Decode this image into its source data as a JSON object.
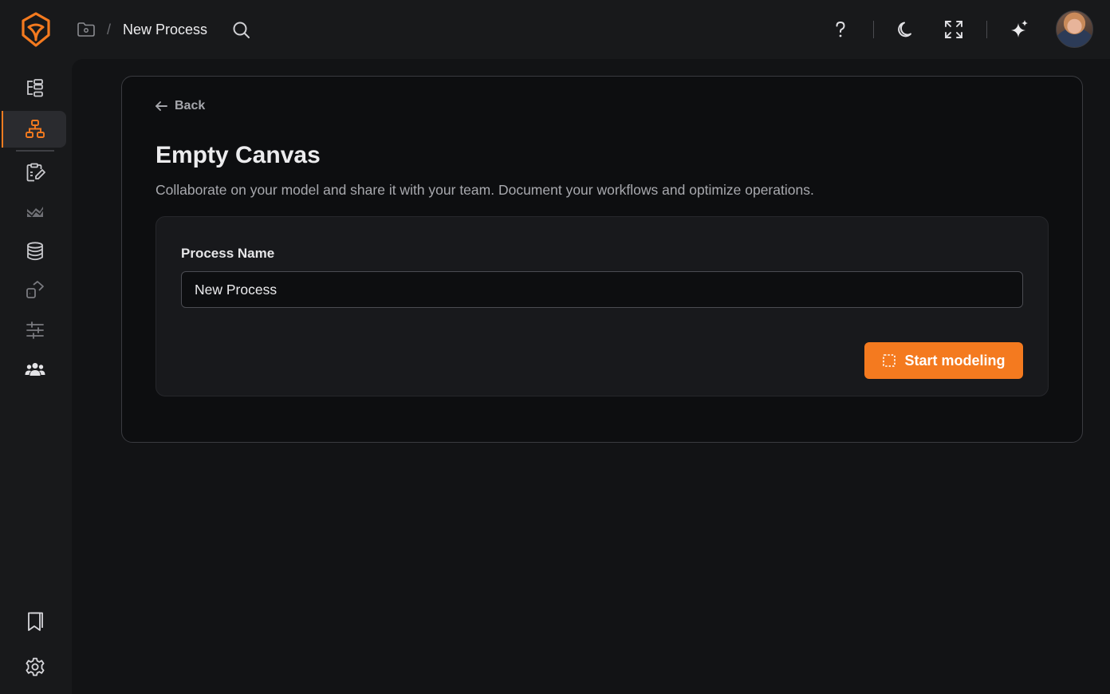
{
  "header": {
    "breadcrumb_separator": "/",
    "process_title": "New Process"
  },
  "sidebar": {
    "items": [
      {
        "icon": "process-tree-icon",
        "active": false
      },
      {
        "icon": "process-model-icon",
        "active": true
      },
      {
        "icon": "tasks-icon",
        "active": false
      },
      {
        "icon": "analytics-icon",
        "active": false
      },
      {
        "icon": "database-icon",
        "active": false
      },
      {
        "icon": "integrations-icon",
        "active": false
      },
      {
        "icon": "filters-icon",
        "active": false
      },
      {
        "icon": "team-icon",
        "active": false
      }
    ],
    "bottom_items": [
      {
        "icon": "bookmark-icon"
      },
      {
        "icon": "settings-icon"
      }
    ]
  },
  "main": {
    "back_label": "Back",
    "title": "Empty Canvas",
    "subtitle": "Collaborate on your model and share it with your team. Document your workflows and optimize operations.",
    "form": {
      "process_name_label": "Process Name",
      "process_name_value": "New Process",
      "submit_label": "Start modeling"
    }
  },
  "colors": {
    "accent": "#f47a1f",
    "background": "#18191b",
    "card_background": "#0d0e10"
  }
}
